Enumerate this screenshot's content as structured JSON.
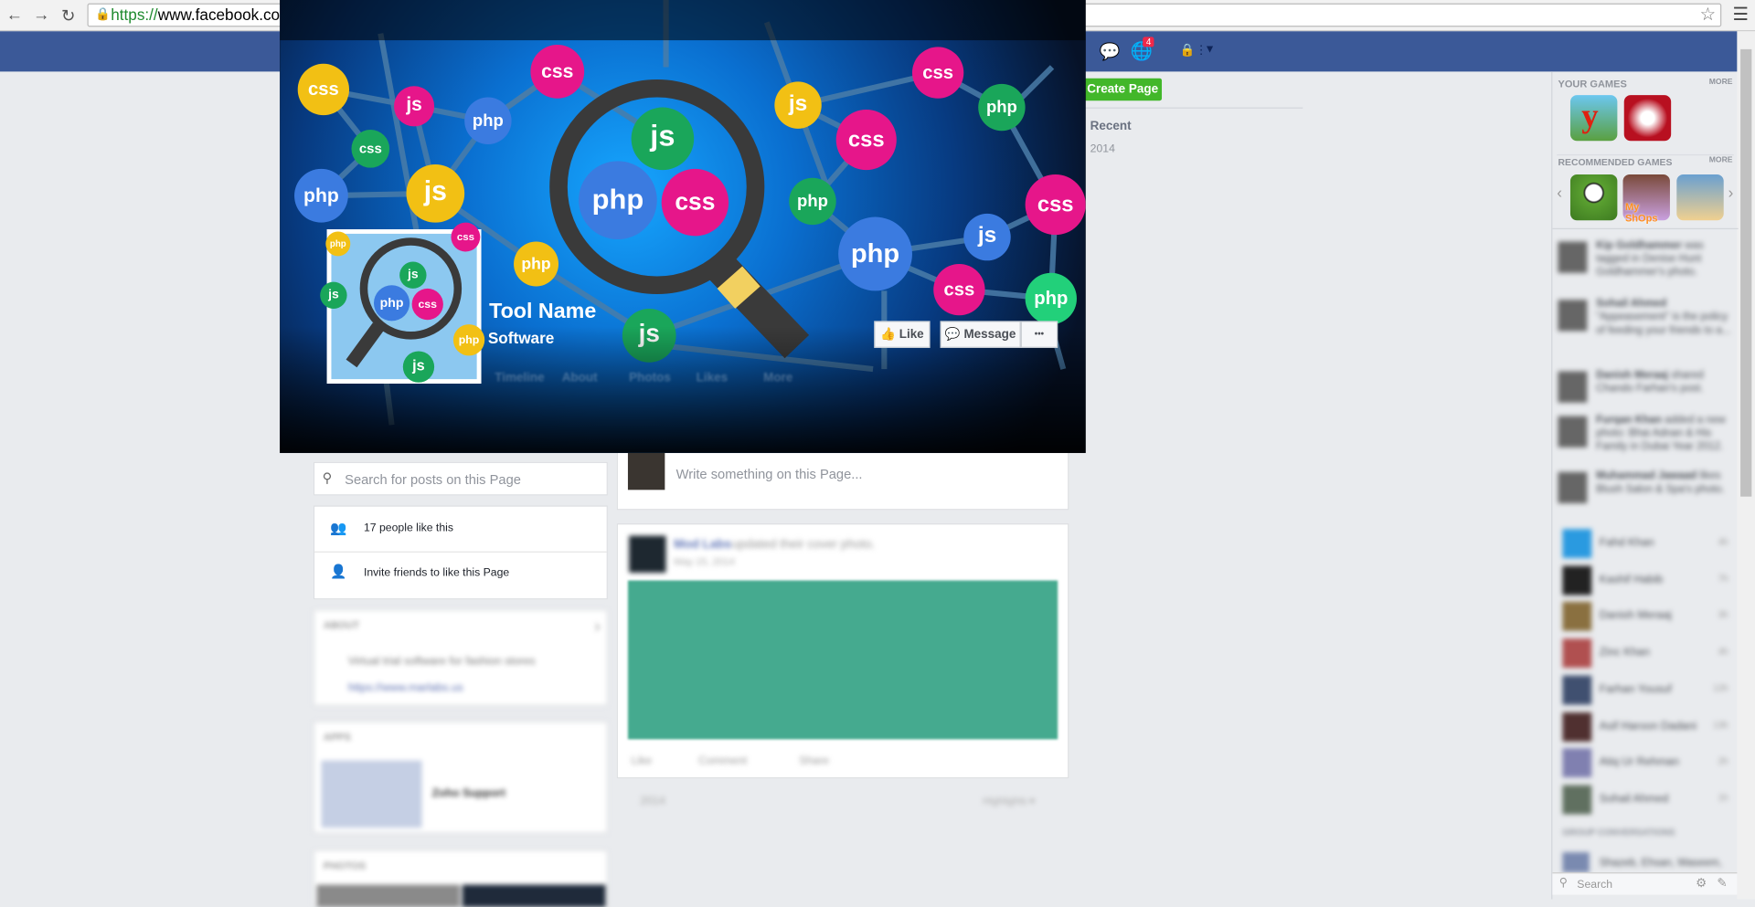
{
  "browser": {
    "url_scheme": "https://",
    "url_host": "www.facebook.com",
    "back": "←",
    "forward": "→",
    "reload": "↻"
  },
  "topbar": {
    "notification_count": "4"
  },
  "cover": {
    "page_name": "Tool Name",
    "category": "Software",
    "like_button": "Like",
    "message_button": "Message",
    "more_button": "•••",
    "tabs": [
      "Timeline",
      "About",
      "Photos",
      "Likes",
      "More"
    ],
    "bubbles": [
      "css",
      "js",
      "php",
      "css",
      "css",
      "php",
      "js",
      "js",
      "php",
      "css",
      "js",
      "css",
      "php",
      "css",
      "php",
      "css",
      "js",
      "php",
      "css",
      "php",
      "php",
      "js"
    ],
    "profile_bubbles": [
      "php",
      "css",
      "js",
      "js",
      "php",
      "css",
      "php",
      "js"
    ],
    "colors": {
      "yellow": "#f2c014",
      "pink": "#e6168a",
      "blue": "#3b7be0",
      "green": "#1aa65a",
      "mint": "#22d07a",
      "background": "#0a6fd0"
    }
  },
  "left": {
    "search_placeholder": "Search for posts on this Page",
    "likes": "17 people like this",
    "invite": "Invite friends to like this Page",
    "about_title": "ABOUT",
    "about_lines": [
      "Virtual trial software for fashion stores",
      "https://www.marlabs.us"
    ],
    "apps_title": "APPS",
    "app_name": "Zoho Support",
    "photos_title": "PHOTOS"
  },
  "composer": {
    "placeholder": "Write something on this Page..."
  },
  "post": {
    "author": "Mod Labs",
    "action": "updated their cover photo.",
    "date": "May 15, 2014",
    "like": "Like",
    "comment": "Comment",
    "share": "Share",
    "image_color": "#45aa8f"
  },
  "timeline_footer": {
    "year": "2014",
    "highlights": "Highlights ▾"
  },
  "right": {
    "create_page": "Create Page",
    "recent": "Recent",
    "year": "2014"
  },
  "sidebar": {
    "your_games": "YOUR GAMES",
    "more": "MORE",
    "recommended": "RECOMMENDED GAMES",
    "recommended_more": "MORE",
    "my_shops": "My ShOps",
    "ticker": [
      {
        "name": "Kip Goldhammer",
        "text": "was tagged in Denise Hunt Goldhammer's photo."
      },
      {
        "name": "Sohail Ahmed",
        "text": "\"Appeasement\" is the policy of feeding your friends to a..."
      },
      {
        "name": "Danish Meraaj",
        "text": "shared Chando Farhan's post."
      },
      {
        "name": "Furqan Khan",
        "text": "added a new photo: Bhai Adnan & His Family in Dubai Year 2012."
      },
      {
        "name": "Muhammad Jawaad",
        "text": "likes Blush Salon & Spa's photo."
      }
    ],
    "chats": [
      {
        "name": "Fahd Khan",
        "time": "4h"
      },
      {
        "name": "Kashif Habib",
        "time": "7h"
      },
      {
        "name": "Danish Meraaj",
        "time": "3h"
      },
      {
        "name": "Zinc Khan",
        "time": "4h"
      },
      {
        "name": "Farhan Yousuf",
        "time": "12h"
      },
      {
        "name": "Asif Haroon Dadani",
        "time": "13h"
      },
      {
        "name": "Atiq Ur Rehman",
        "time": "2h"
      },
      {
        "name": "Sohail Ahmed",
        "time": "1h"
      }
    ],
    "group_title": "GROUP CONVERSATIONS",
    "group_name": "Shazeb, Ehsan, Waseem,",
    "chat_search": "Search"
  }
}
